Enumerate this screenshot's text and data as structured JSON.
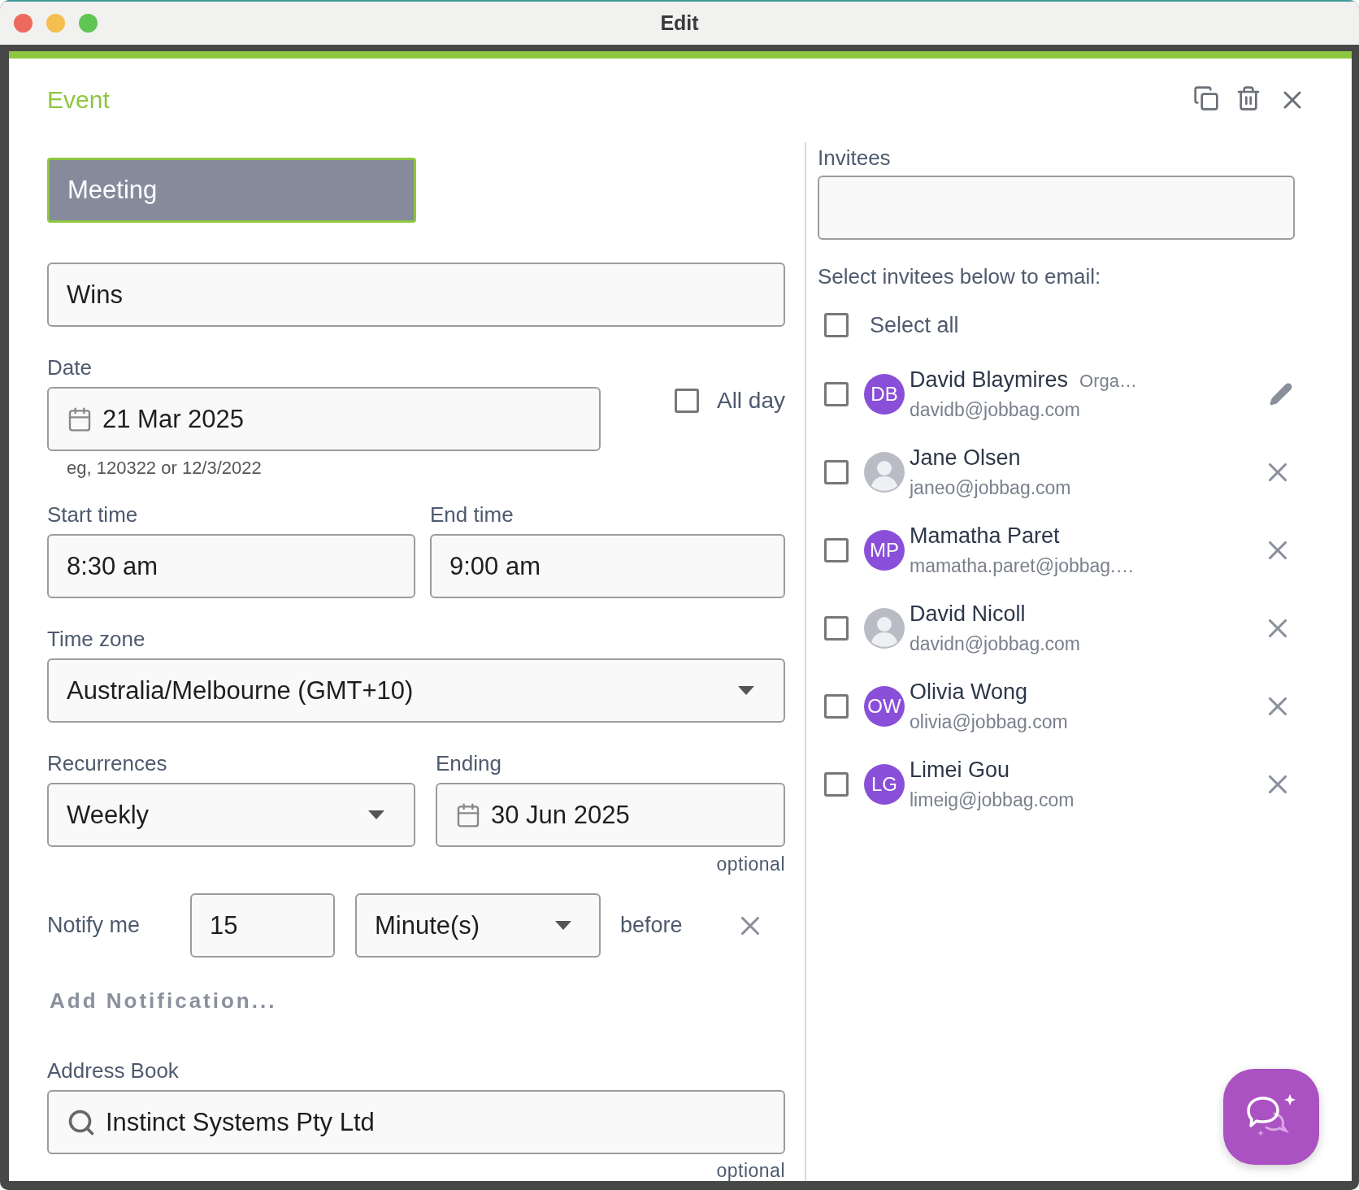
{
  "window": {
    "title": "Edit"
  },
  "header": {
    "title": "Event"
  },
  "event_type": {
    "value": "Meeting"
  },
  "subject": {
    "value": "Wins"
  },
  "date": {
    "label": "Date",
    "value": "21 Mar 2025",
    "hint": "eg, 120322 or 12/3/2022"
  },
  "all_day": {
    "label": "All day",
    "checked": false
  },
  "start_time": {
    "label": "Start time",
    "value": "8:30 am"
  },
  "end_time": {
    "label": "End time",
    "value": "9:00 am"
  },
  "time_zone": {
    "label": "Time zone",
    "value": "Australia/Melbourne (GMT+10)"
  },
  "recurrences": {
    "label": "Recurrences",
    "value": "Weekly"
  },
  "ending": {
    "label": "Ending",
    "value": "30 Jun 2025",
    "note": "optional"
  },
  "notification": {
    "label": "Notify me",
    "amount": "15",
    "unit": "Minute(s)",
    "suffix": "before"
  },
  "add_notification": "Add Notification...",
  "address_book": {
    "label": "Address Book",
    "value": "Instinct Systems Pty Ltd",
    "note": "optional"
  },
  "invitees": {
    "label": "Invitees",
    "instruction": "Select invitees below to email:",
    "select_all": {
      "label": "Select all",
      "checked": false
    },
    "people": [
      {
        "name": "David Blaymires",
        "role": "Orga…",
        "email": "davidb@jobbag.com",
        "avatar": {
          "kind": "initials",
          "initials": "DB"
        },
        "action": {
          "kind": "edit"
        },
        "checked": false
      },
      {
        "name": "Jane Olsen",
        "email": "janeo@jobbag.com",
        "avatar": {
          "kind": "photo"
        },
        "action": {
          "kind": "remove"
        },
        "checked": false
      },
      {
        "name": "Mamatha Paret",
        "email": "mamatha.paret@jobbag.…",
        "avatar": {
          "kind": "initials",
          "initials": "MP"
        },
        "action": {
          "kind": "remove"
        },
        "checked": false
      },
      {
        "name": "David Nicoll",
        "email": "davidn@jobbag.com",
        "avatar": {
          "kind": "photo"
        },
        "action": {
          "kind": "remove"
        },
        "checked": false
      },
      {
        "name": "Olivia Wong",
        "email": "olivia@jobbag.com",
        "avatar": {
          "kind": "initials",
          "initials": "OW"
        },
        "action": {
          "kind": "remove"
        },
        "checked": false
      },
      {
        "name": "Limei Gou",
        "email": "limeig@jobbag.com",
        "avatar": {
          "kind": "initials",
          "initials": "LG"
        },
        "action": {
          "kind": "remove"
        },
        "checked": false
      }
    ]
  }
}
